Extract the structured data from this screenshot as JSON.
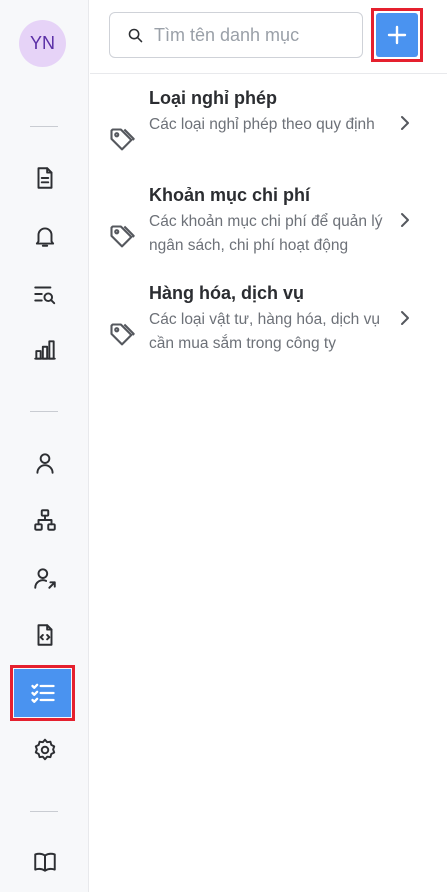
{
  "user": {
    "initials": "YN"
  },
  "search": {
    "placeholder": "Tìm tên danh mục",
    "value": ""
  },
  "nav": {
    "items": [
      {
        "icon": "document-icon"
      },
      {
        "icon": "bell-icon"
      },
      {
        "icon": "search-list-icon"
      },
      {
        "icon": "bar-chart-icon"
      },
      {
        "icon": "user-icon"
      },
      {
        "icon": "org-chart-icon"
      },
      {
        "icon": "user-share-icon"
      },
      {
        "icon": "code-file-icon"
      },
      {
        "icon": "checklist-icon",
        "active": true
      },
      {
        "icon": "gear-icon"
      },
      {
        "icon": "book-icon"
      }
    ]
  },
  "categories": [
    {
      "title": "Loại nghỉ phép",
      "description": "Các loại nghỉ phép theo quy định"
    },
    {
      "title": "Khoản mục chi phí",
      "description": "Các khoản mục chi phí để quản lý ngân sách, chi phí hoạt động"
    },
    {
      "title": "Hàng hóa, dịch vụ",
      "description": "Các loại vật tư, hàng hóa, dịch vụ cần mua sắm trong công ty"
    }
  ],
  "colors": {
    "accent": "#4a93f0",
    "highlight": "#e5202e",
    "avatar_bg": "#e6d3f7",
    "avatar_text": "#5a2ea6"
  }
}
